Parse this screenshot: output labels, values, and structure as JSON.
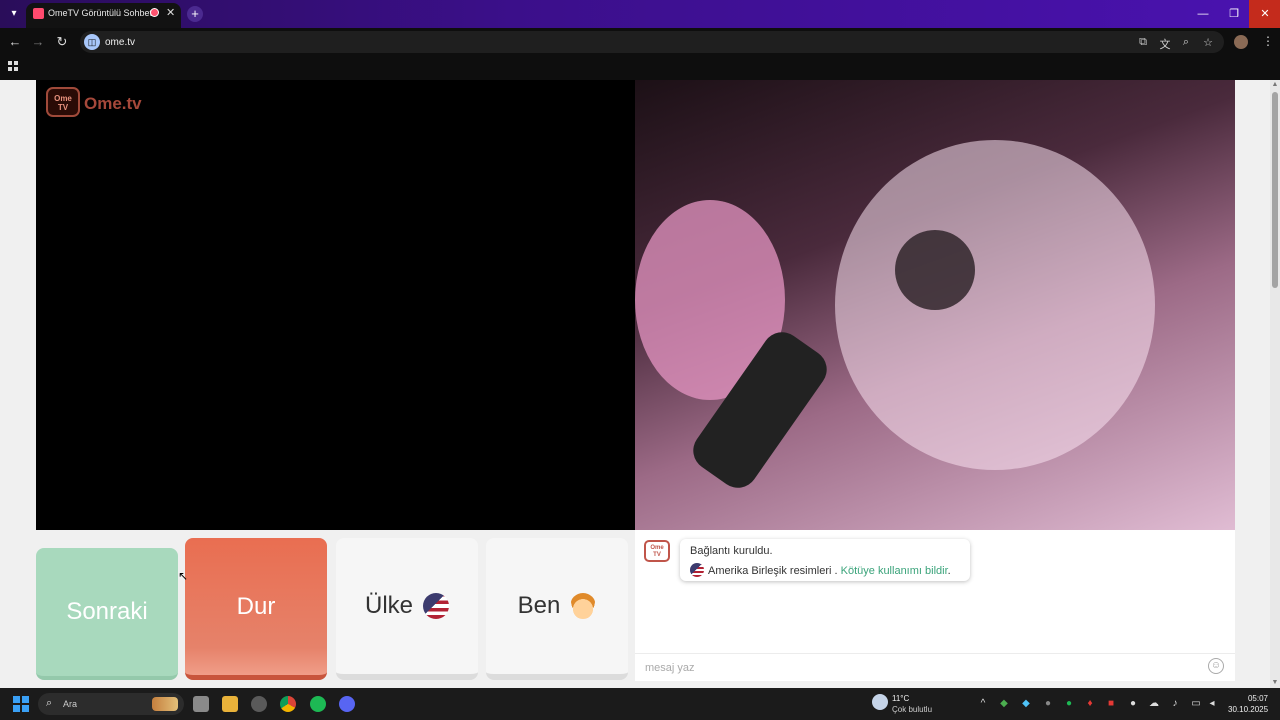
{
  "browser": {
    "tab_title": "OmeTV Görüntülü Sohbet -",
    "url": "ome.tv"
  },
  "page": {
    "logo_small": "Ome TV",
    "logo_text": "Ome.tv",
    "buttons": {
      "next": "Sonraki",
      "stop": "Dur",
      "country": "Ülke",
      "me": "Ben"
    },
    "chat": {
      "logo": "Ome TV",
      "message1": "Bağlantı kuruldu.",
      "message2_prefix": "Amerika Birleşik resimleri . ",
      "report_link": "Kötüye kullanımı bildir",
      "message2_suffix": ".",
      "input_placeholder": "mesaj yaz"
    }
  },
  "taskbar": {
    "search_label": "Ara",
    "weather_temp": "11°C",
    "weather_desc": "Çok bulutlu",
    "time": "05:07",
    "date": "30.10.2025"
  },
  "colors": {
    "next_button": "#a8d9bd",
    "stop_button": "#e96e51",
    "report_link": "#3aa37a",
    "tab_bar": "#3b0f8a"
  },
  "icons": [
    "tab-list-icon",
    "tab-favicon",
    "recording-icon",
    "close-icon",
    "new-tab-icon",
    "minimize-icon",
    "maximize-icon",
    "window-close-icon",
    "back-icon",
    "forward-icon",
    "reload-icon",
    "site-info-icon",
    "cast-icon",
    "translate-icon",
    "zoom-icon",
    "bookmark-star-icon",
    "profile-icon",
    "menu-icon",
    "apps-icon",
    "us-flag-icon",
    "boy-avatar-icon",
    "emoji-icon",
    "windows-start-icon",
    "search-icon"
  ]
}
